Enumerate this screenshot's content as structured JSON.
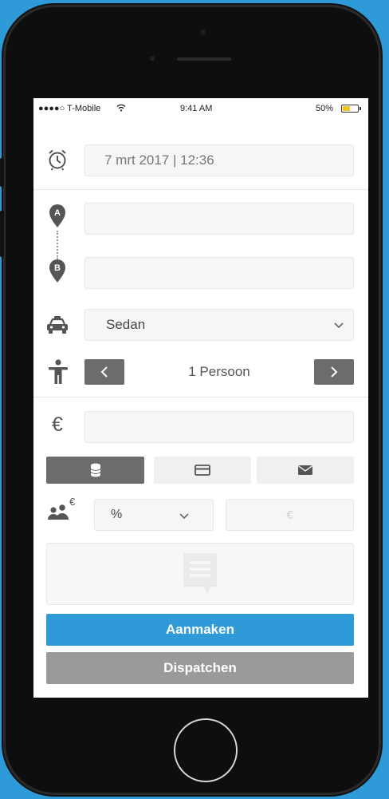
{
  "status": {
    "carrier": "●●●●○ T-Mobile",
    "time": "9:41 AM",
    "battery": "50%",
    "battery_level": 0.5
  },
  "form": {
    "datetime_value": "7 mrt 2017 | 12:36",
    "pickup_marker": "A",
    "dropoff_marker": "B",
    "pickup_value": "",
    "dropoff_value": "",
    "vehicle_value": "Sedan",
    "passengers_value": "1 Persoon",
    "price_symbol": "€",
    "price_value": "",
    "commission_badge": "€",
    "commission_type": "%",
    "commission_amount_placeholder": "€",
    "notes_value": ""
  },
  "payment_methods": [
    "cash",
    "card",
    "invoice"
  ],
  "payment_selected": "cash",
  "actions": {
    "create_label": "Aanmaken",
    "dispatch_label": "Dispatchen"
  },
  "icons": {
    "clock": "alarm-clock-icon",
    "vehicle": "car-icon",
    "passenger": "person-icon",
    "commission": "people-euro-icon",
    "notes": "note-icon"
  },
  "colors": {
    "background": "#2e9bd8",
    "primary_button": "#2e9bd8",
    "secondary_button": "#9a9a9a",
    "selected_payment": "#6c6c6c",
    "battery": "#f0c419"
  }
}
